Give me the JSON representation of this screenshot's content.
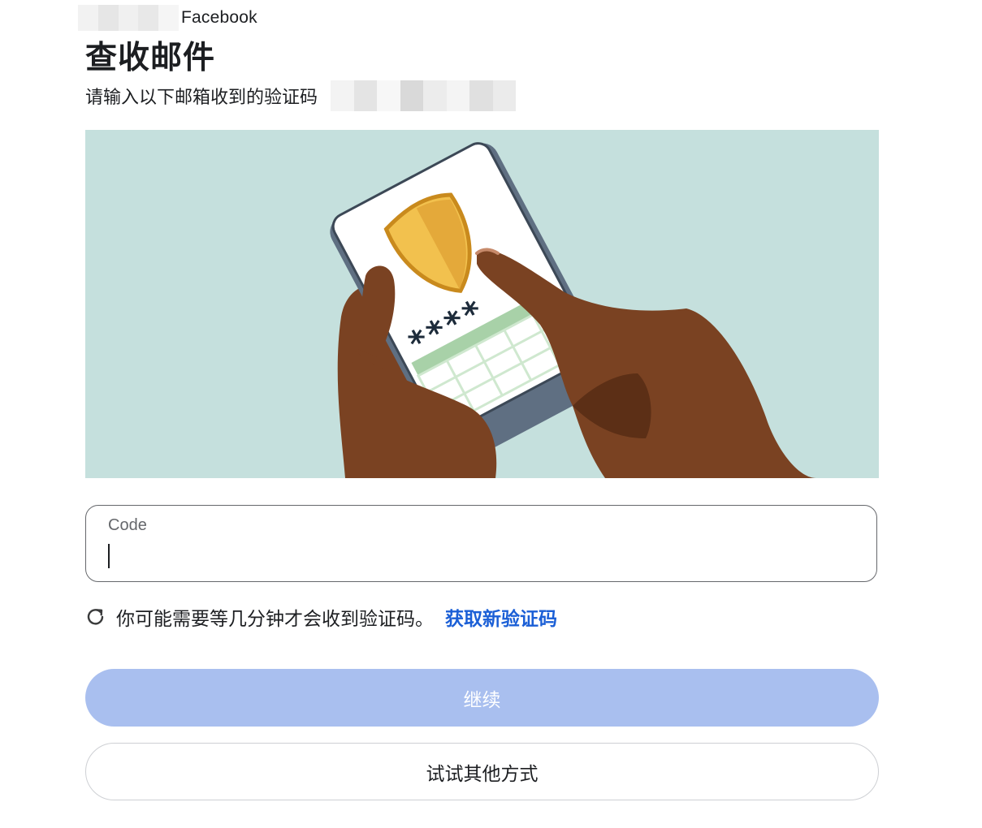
{
  "header": {
    "account_suffix": "Facebook",
    "title": "查收邮件",
    "subtitle": "请输入以下邮箱收到的验证码"
  },
  "illustration": {
    "icon": "phone-security-code-illustration",
    "masked_code": "****",
    "colors": {
      "background": "#c5e0dd",
      "shield": "#f2c14e",
      "skin": "#7a4222",
      "phone_frame": "#5f6f82"
    }
  },
  "code_field": {
    "label": "Code",
    "value": ""
  },
  "notice": {
    "icon": "refresh-icon",
    "text": "你可能需要等几分钟才会收到验证码。",
    "resend_link": "获取新验证码"
  },
  "actions": {
    "continue_label": "继续",
    "alternative_label": "试试其他方式"
  },
  "colors": {
    "link": "#1b5fd6",
    "primary_button_disabled": "#a9bfef",
    "text": "#1c1e21",
    "border": "#65676b"
  }
}
